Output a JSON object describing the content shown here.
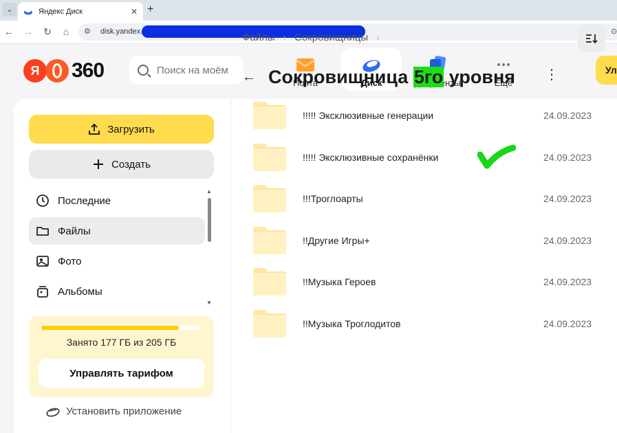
{
  "browser": {
    "tab_title": "Яндекс Диск",
    "tab_close": "✕",
    "new_tab": "+",
    "url": "disk.yandex.r"
  },
  "header": {
    "logo_letter": "Я",
    "logo_number": "360",
    "search_placeholder": "Поиск на моём",
    "apps": [
      {
        "label": "Почта"
      },
      {
        "label": "Диск"
      },
      {
        "label": "Документы"
      },
      {
        "label": "Ещё"
      }
    ],
    "upgrade_label": "Ул"
  },
  "sidebar": {
    "upload_label": "Загрузить",
    "create_label": "Создать",
    "items": [
      {
        "label": "Последние"
      },
      {
        "label": "Файлы"
      },
      {
        "label": "Фото"
      },
      {
        "label": "Альбомы"
      }
    ],
    "storage": {
      "used_fraction": 0.863,
      "text": "Занято 177 ГБ из 205 ГБ",
      "tariff_label": "Управлять тарифом"
    },
    "install_label": "Установить приложение"
  },
  "content": {
    "breadcrumbs": [
      "Файлы",
      "Сокровищницы"
    ],
    "title_before": "Сокровищница ",
    "title_highlight": "5го",
    "title_after": " уровня",
    "files": [
      {
        "name": "!!!!! Эксклюзивные генерации",
        "date": "24.09.2023"
      },
      {
        "name": "!!!!! Эксклюзивные сохранёнки",
        "date": "24.09.2023"
      },
      {
        "name": "!!!Троглоарты",
        "date": "24.09.2023"
      },
      {
        "name": "!!Другие Игры+",
        "date": "24.09.2023"
      },
      {
        "name": "!!Музыка Героев",
        "date": "24.09.2023"
      },
      {
        "name": "!!Музыка Троглодитов",
        "date": "24.09.2023"
      }
    ]
  },
  "colors": {
    "accent_yellow": "#ffdb4d",
    "highlight_green": "#18e014",
    "logo_red": "#fc3f1d"
  }
}
